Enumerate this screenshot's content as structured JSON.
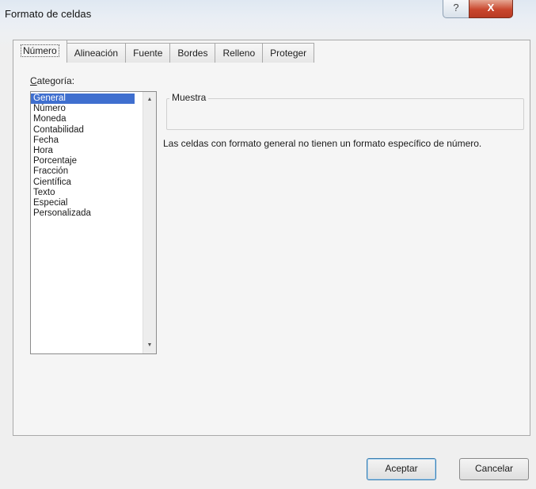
{
  "window": {
    "title": "Formato de celdas",
    "help_glyph": "?",
    "close_glyph": "X"
  },
  "tabs": [
    {
      "label": "Número",
      "active": true
    },
    {
      "label": "Alineación",
      "active": false
    },
    {
      "label": "Fuente",
      "active": false
    },
    {
      "label": "Bordes",
      "active": false
    },
    {
      "label": "Relleno",
      "active": false
    },
    {
      "label": "Proteger",
      "active": false
    }
  ],
  "category": {
    "label_first": "C",
    "label_rest": "ategoría:",
    "items": [
      "General",
      "Número",
      "Moneda",
      "Contabilidad",
      "Fecha",
      "Hora",
      "Porcentaje",
      "Fracción",
      "Científica",
      "Texto",
      "Especial",
      "Personalizada"
    ],
    "selected": "General",
    "scroll_up_glyph": "▲",
    "scroll_down_glyph": "▼"
  },
  "sample": {
    "label": "Muestra",
    "value": ""
  },
  "description": "Las celdas con formato general no tienen un formato específico de número.",
  "buttons": {
    "ok": "Aceptar",
    "cancel": "Cancelar"
  },
  "colors": {
    "selection": "#3f6fcf",
    "close_button": "#c9472e"
  }
}
